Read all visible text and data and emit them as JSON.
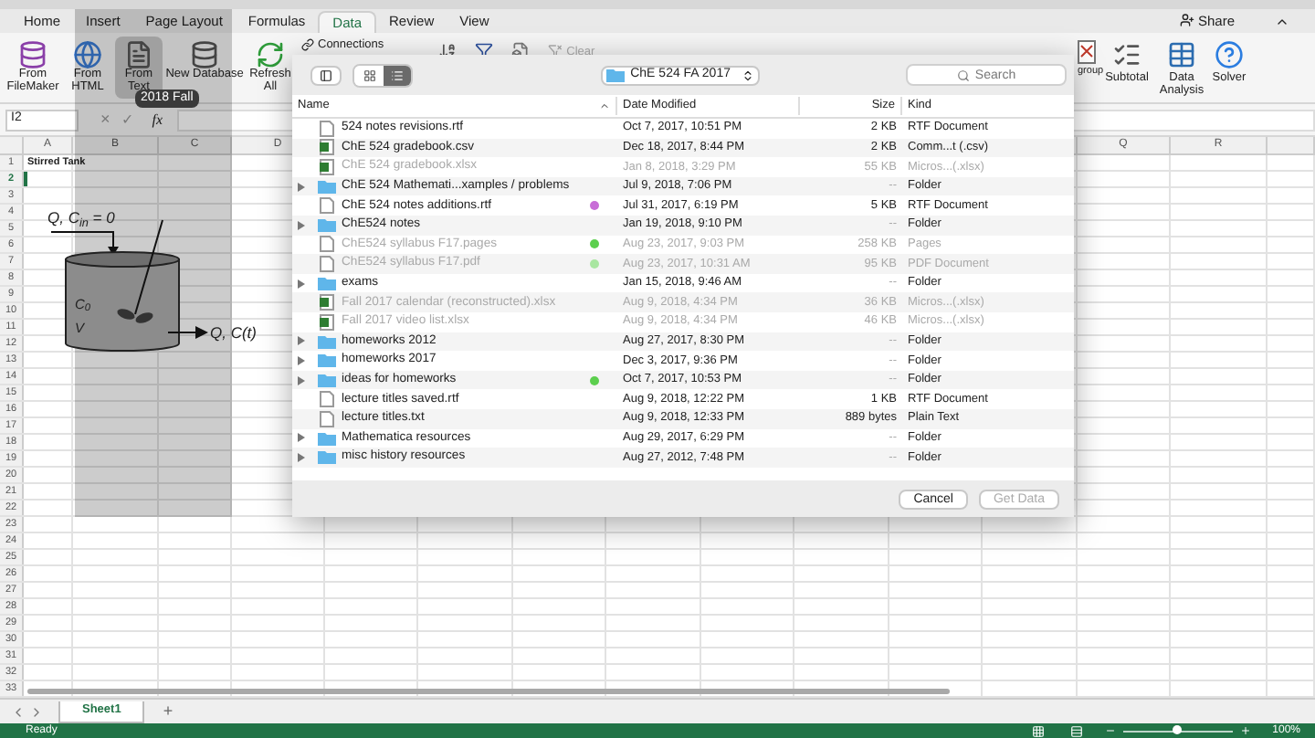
{
  "tabs": [
    {
      "label": "Home",
      "selected": false
    },
    {
      "label": "Insert",
      "selected": false
    },
    {
      "label": "Page Layout",
      "selected": false
    },
    {
      "label": "Formulas",
      "selected": false
    },
    {
      "label": "Data",
      "selected": true
    },
    {
      "label": "Review",
      "selected": false
    },
    {
      "label": "View",
      "selected": false
    }
  ],
  "share": "Share",
  "ribbon_left": [
    {
      "label": "From FileMaker",
      "kind": "filemaker",
      "pressed": false
    },
    {
      "label": "From HTML",
      "kind": "html",
      "pressed": false
    },
    {
      "label": "From Text",
      "kind": "text",
      "pressed": true
    },
    {
      "label": "New Database",
      "kind": "database",
      "pressed": false
    },
    {
      "label": "Refresh All",
      "kind": "refresh",
      "pressed": false
    }
  ],
  "connections": {
    "label": "Connections",
    "disabled": false
  },
  "clear": {
    "label": "Clear",
    "disabled": true
  },
  "ribbon_right": [
    {
      "label": "group",
      "kind": "ungroup"
    },
    {
      "label": "Subtotal",
      "kind": "subtotal"
    },
    {
      "label": "Data Analysis",
      "kind": "analysis"
    },
    {
      "label": "Solver",
      "kind": "solver"
    }
  ],
  "tooltip": "2018 Fall",
  "formula_bar": {
    "name_box": "I2",
    "cancel": "×",
    "enter": "✓",
    "fx": "fx"
  },
  "columns_left": [
    "A",
    "B",
    "C",
    "D"
  ],
  "columns_right": [
    "Q",
    "R"
  ],
  "rows": [
    {
      "label": "1",
      "active": false,
      "text": "Stirred Tank"
    },
    {
      "label": "2",
      "active": true
    },
    {
      "label": "3",
      "active": false
    },
    {
      "label": "4",
      "active": false
    },
    {
      "label": "5",
      "active": false
    },
    {
      "label": "6",
      "active": false
    },
    {
      "label": "7",
      "active": false
    },
    {
      "label": "8",
      "active": false
    },
    {
      "label": "9",
      "active": false
    },
    {
      "label": "10",
      "active": false
    },
    {
      "label": "11",
      "active": false
    },
    {
      "label": "12",
      "active": false
    },
    {
      "label": "13",
      "active": false
    },
    {
      "label": "14",
      "active": false
    },
    {
      "label": "15",
      "active": false
    },
    {
      "label": "16",
      "active": false
    },
    {
      "label": "17",
      "active": false
    },
    {
      "label": "18",
      "active": false
    },
    {
      "label": "19",
      "active": false
    },
    {
      "label": "20",
      "active": false
    },
    {
      "label": "21",
      "active": false
    },
    {
      "label": "22",
      "active": false
    },
    {
      "label": "23",
      "active": false
    },
    {
      "label": "24",
      "active": false
    },
    {
      "label": "25",
      "active": false
    },
    {
      "label": "26",
      "active": false
    },
    {
      "label": "27",
      "active": false
    },
    {
      "label": "28",
      "active": false
    },
    {
      "label": "29",
      "active": false
    },
    {
      "label": "30",
      "active": false
    },
    {
      "label": "31",
      "active": false
    },
    {
      "label": "32",
      "active": false
    },
    {
      "label": "33",
      "active": false
    }
  ],
  "diagram": {
    "inlet": "Q, C$_{in}$ = 0",
    "initial": "C$_{0}$",
    "volume": "V",
    "outlet": "Q, C(t)"
  },
  "dialog": {
    "views": [
      {
        "kind": "icons",
        "selected": false
      },
      {
        "kind": "list",
        "selected": true
      }
    ],
    "location": "ChE 524 FA 2017",
    "search_placeholder": "Search",
    "columns": [
      "Name",
      "Date Modified",
      "Size",
      "Kind"
    ],
    "files": [
      {
        "name": "524 notes revisions.rtf",
        "date": "Oct 7, 2017, 10:51 PM",
        "size": "2 KB",
        "type": "RTF Document",
        "kind": "document",
        "disabled": false
      },
      {
        "name": "ChE 524 gradebook.csv",
        "date": "Dec 18, 2017, 8:44 PM",
        "size": "2 KB",
        "type": "Comm...t (.csv)",
        "kind": "spreadsheet",
        "disabled": false
      },
      {
        "name": "ChE 524 gradebook.xlsx",
        "date": "Jan 8, 2018, 3:29 PM",
        "size": "55 KB",
        "type": "Micros...(.xlsx)",
        "kind": "spreadsheet",
        "disabled": true
      },
      {
        "name": "ChE 524 Mathemati...xamples / problems",
        "date": "Jul 9, 2018, 7:06 PM",
        "size": "--",
        "type": "Folder",
        "kind": "folder",
        "disabled": false
      },
      {
        "name": "ChE 524 notes additions.rtf",
        "date": "Jul 31, 2017, 6:19 PM",
        "size": "5 KB",
        "type": "RTF Document",
        "kind": "document",
        "disabled": false,
        "color": "#c86dd7"
      },
      {
        "name": "ChE524 notes",
        "date": "Jan 19, 2018, 9:10 PM",
        "size": "--",
        "type": "Folder",
        "kind": "folder",
        "disabled": false
      },
      {
        "name": "ChE524 syllabus F17.pages",
        "date": "Aug 23, 2017, 9:03 PM",
        "size": "258 KB",
        "type": "Pages",
        "kind": "document",
        "disabled": true,
        "color": "#5ccf4e"
      },
      {
        "name": "ChE524 syllabus F17.pdf",
        "date": "Aug 23, 2017, 10:31 AM",
        "size": "95 KB",
        "type": "PDF Document",
        "kind": "document",
        "disabled": true,
        "color": "#a9e6a1"
      },
      {
        "name": "exams",
        "date": "Jan 15, 2018, 9:46 AM",
        "size": "--",
        "type": "Folder",
        "kind": "folder",
        "disabled": false
      },
      {
        "name": "Fall 2017 calendar (reconstructed).xlsx",
        "date": "Aug 9, 2018, 4:34 PM",
        "size": "36 KB",
        "type": "Micros...(.xlsx)",
        "kind": "spreadsheet",
        "disabled": true
      },
      {
        "name": "Fall 2017 video list.xlsx",
        "date": "Aug 9, 2018, 4:34 PM",
        "size": "46 KB",
        "type": "Micros...(.xlsx)",
        "kind": "spreadsheet",
        "disabled": true
      },
      {
        "name": "homeworks 2012",
        "date": "Aug 27, 2017, 8:30 PM",
        "size": "--",
        "type": "Folder",
        "kind": "folder",
        "disabled": false
      },
      {
        "name": "homeworks 2017",
        "date": "Dec 3, 2017, 9:36 PM",
        "size": "--",
        "type": "Folder",
        "kind": "folder",
        "disabled": false
      },
      {
        "name": "ideas for homeworks",
        "date": "Oct 7, 2017, 10:53 PM",
        "size": "--",
        "type": "Folder",
        "kind": "folder",
        "disabled": false,
        "color": "#5ccf4e"
      },
      {
        "name": "lecture titles saved.rtf",
        "date": "Aug 9, 2018, 12:22 PM",
        "size": "1 KB",
        "type": "RTF Document",
        "kind": "document",
        "disabled": false
      },
      {
        "name": "lecture titles.txt",
        "date": "Aug 9, 2018, 12:33 PM",
        "size": "889 bytes",
        "type": "Plain Text",
        "kind": "document",
        "disabled": false
      },
      {
        "name": "Mathematica resources",
        "date": "Aug 29, 2017, 6:29 PM",
        "size": "--",
        "type": "Folder",
        "kind": "folder",
        "disabled": false
      },
      {
        "name": "misc history resources",
        "date": "Aug 27, 2012, 7:48 PM",
        "size": "--",
        "type": "Folder",
        "kind": "folder",
        "disabled": false
      }
    ],
    "buttons": [
      {
        "label": "Cancel",
        "disabled": false
      },
      {
        "label": "Get Data",
        "disabled": true
      }
    ]
  },
  "sheet_tabs": [
    {
      "label": "Sheet1",
      "selected": true
    }
  ],
  "add_sheet": "+",
  "status": {
    "text": "Ready",
    "zoom": "100%",
    "level": 0.5
  }
}
